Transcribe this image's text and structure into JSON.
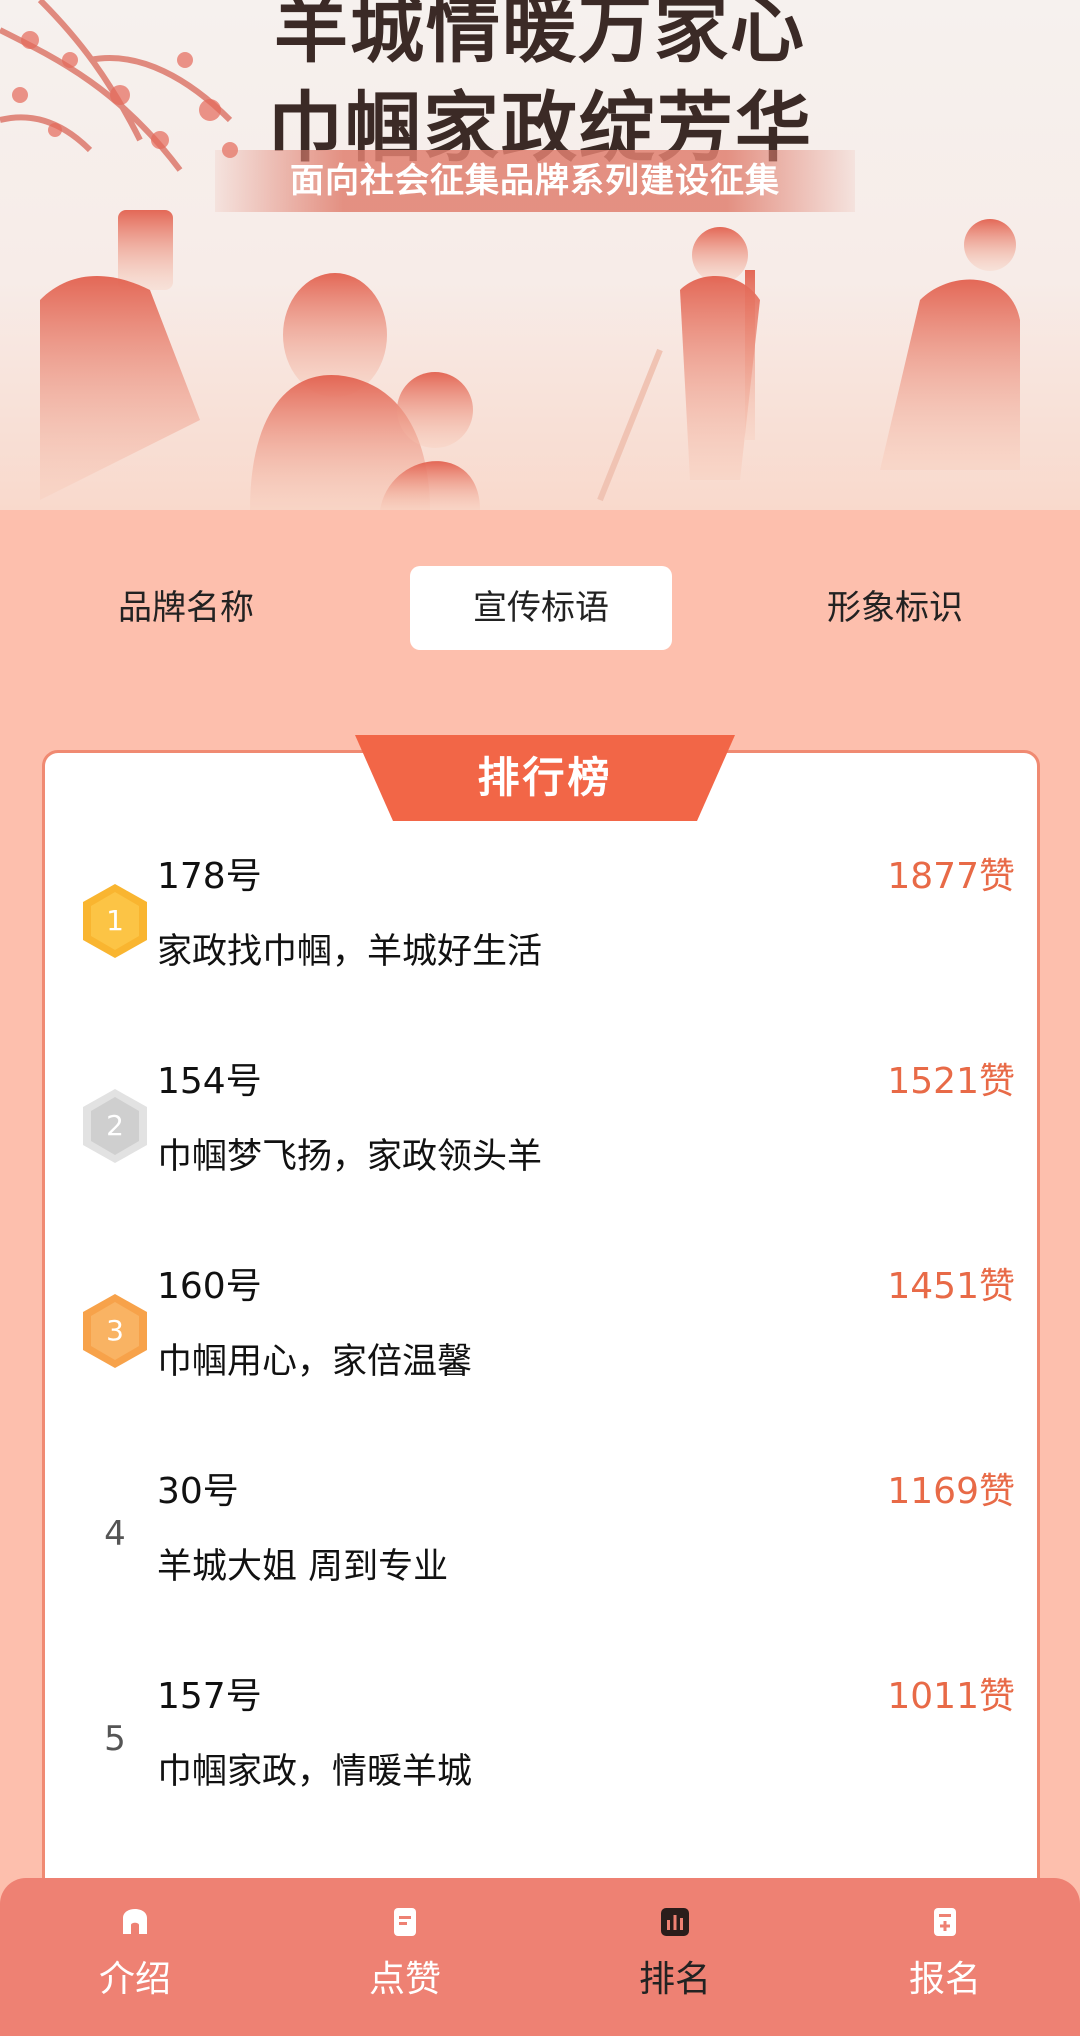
{
  "banner": {
    "title_line1": "羊城情暖万家心",
    "title_line2": "巾帼家政绽芳华",
    "subtitle": "面向社会征集品牌系列建设征集"
  },
  "tabs": [
    {
      "label": "品牌名称",
      "active": false
    },
    {
      "label": "宣传标语",
      "active": true
    },
    {
      "label": "形象标识",
      "active": false
    }
  ],
  "ranking": {
    "title": "排行榜",
    "items": [
      {
        "rank": "1",
        "id": "178号",
        "likes": "1877赞",
        "slogan": "家政找巾帼，羊城好生活",
        "badge_color": "#f9b530"
      },
      {
        "rank": "2",
        "id": "154号",
        "likes": "1521赞",
        "slogan": "巾帼梦飞扬，家政领头羊",
        "badge_color": "#d9d9d9"
      },
      {
        "rank": "3",
        "id": "160号",
        "likes": "1451赞",
        "slogan": "巾帼用心，家倍温馨",
        "badge_color": "#f7a24a"
      },
      {
        "rank": "4",
        "id": "30号",
        "likes": "1169赞",
        "slogan": "羊城大姐 周到专业"
      },
      {
        "rank": "5",
        "id": "157号",
        "likes": "1011赞",
        "slogan": "巾帼家政，情暖羊城"
      }
    ]
  },
  "bottom_nav": [
    {
      "label": "介绍",
      "icon": "home-icon",
      "active": false
    },
    {
      "label": "点赞",
      "icon": "document-icon",
      "active": false
    },
    {
      "label": "排名",
      "icon": "bar-chart-icon",
      "active": true
    },
    {
      "label": "报名",
      "icon": "register-icon",
      "active": false
    }
  ],
  "colors": {
    "page_bg": "#fdbfad",
    "accent": "#f26647",
    "likes": "#e86a47",
    "nav_bg": "#ee8173"
  }
}
